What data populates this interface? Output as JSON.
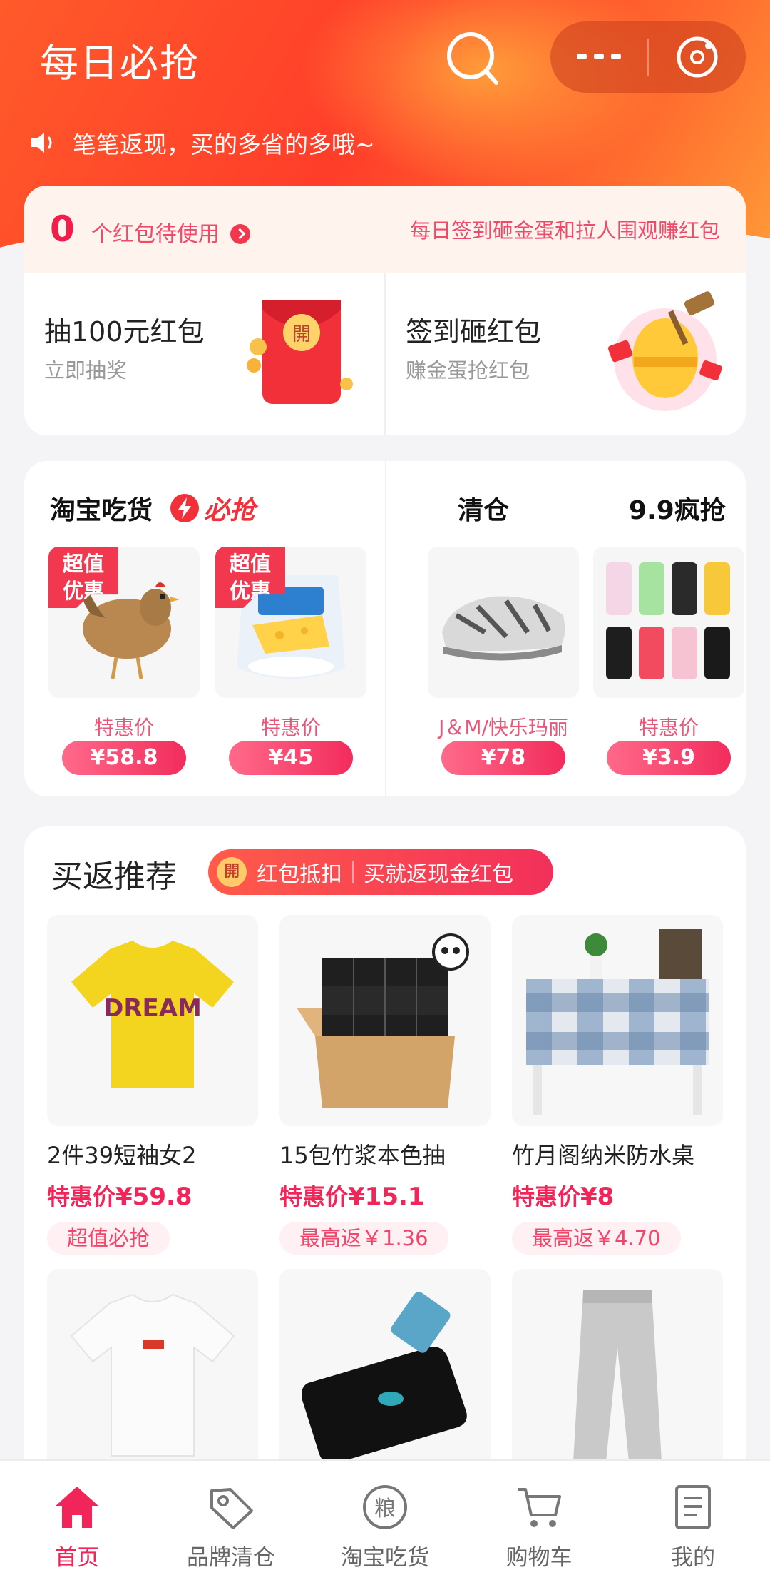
{
  "header": {
    "title": "每日必抢",
    "notice": "笔笔返现，买的多省的多哦~"
  },
  "redpack": {
    "count": "0",
    "count_label": "个红包待使用",
    "right_link": "每日签到砸金蛋和拉人围观赚红包",
    "items": [
      {
        "title": "抽100元红包",
        "subtitle": "立即抽奖",
        "img_text": "開"
      },
      {
        "title": "签到砸红包",
        "subtitle": "赚金蛋抢红包"
      }
    ]
  },
  "promo": {
    "left_title": "淘宝吃货",
    "left_badge": "必抢",
    "right_titles": [
      "清仓",
      "9.9疯抢"
    ],
    "products": [
      {
        "badge": [
          "超值",
          "优惠"
        ],
        "label": "特惠价",
        "price": "¥58.8"
      },
      {
        "badge": [
          "超值",
          "优惠"
        ],
        "label": "特惠价",
        "price": "¥45"
      },
      {
        "label": "J＆M/快乐玛丽",
        "price": "¥78"
      },
      {
        "label": "特惠价",
        "price": "¥3.9"
      }
    ]
  },
  "recommend": {
    "title": "买返推荐",
    "banner_coin": "開",
    "banner_left": "红包抵扣",
    "banner_right": "买就返现金红包",
    "items": [
      {
        "name": "2件39短袖女2",
        "price_label": "特惠价",
        "price": "¥59.8",
        "tag": "超值必抢"
      },
      {
        "name": "15包竹浆本色抽",
        "price_label": "特惠价",
        "price": "¥15.1",
        "tag": "最高返￥1.36"
      },
      {
        "name": "竹月阁纳米防水桌",
        "price_label": "特惠价",
        "price": "¥8",
        "tag": "最高返￥4.70"
      },
      {
        "name": "",
        "price_label": "",
        "price": "",
        "tag": ""
      },
      {
        "name": "",
        "price_label": "",
        "price": "",
        "tag": ""
      },
      {
        "name": "",
        "price_label": "",
        "price": "",
        "tag": ""
      }
    ],
    "tshirt_text": "DREAM"
  },
  "tabbar": {
    "tabs": [
      {
        "label": "首页",
        "icon": "home-icon",
        "active": true
      },
      {
        "label": "品牌清仓",
        "icon": "tag-icon"
      },
      {
        "label": "淘宝吃货",
        "icon": "grain-icon",
        "icon_text": "粮"
      },
      {
        "label": "购物车",
        "icon": "cart-icon"
      },
      {
        "label": "我的",
        "icon": "document-icon"
      }
    ]
  },
  "colors": {
    "accent": "#f2255a",
    "hero_orange": "#ff4a2a"
  }
}
